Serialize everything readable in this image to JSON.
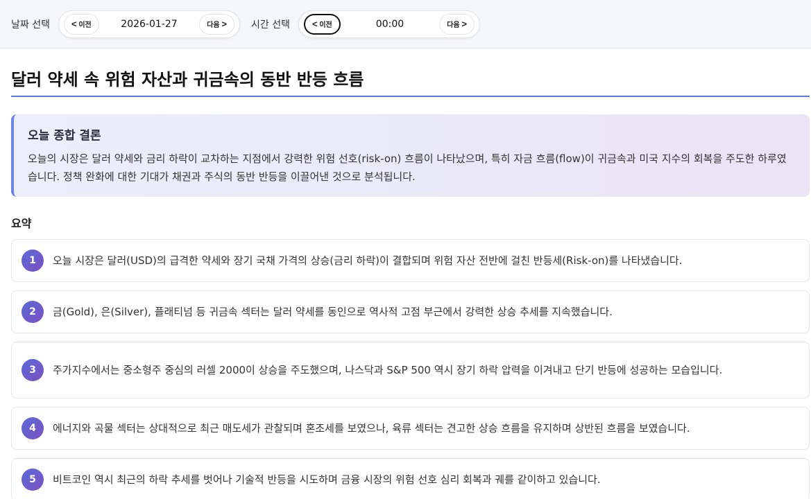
{
  "toolbar": {
    "date_label": "날짜 선택",
    "date_value": "2026-01-27",
    "time_label": "시간 선택",
    "time_value": "00:00",
    "prev_label": "이전",
    "next_label": "다음",
    "prev_glyph": "<",
    "next_glyph": ">"
  },
  "main": {
    "title": "달러 약세 속 위험 자산과 귀금속의 동반 반등 흐름",
    "conclusion": {
      "heading": "오늘 종합 결론",
      "body": "오늘의 시장은 달러 약세와 금리 하락이 교차하는 지점에서 강력한 위험 선호(risk-on) 흐름이 나타났으며, 특히 자금 흐름(flow)이 귀금속과 미국 지수의 회복을 주도한 하루였습니다. 정책 완화에 대한 기대가 채권과 주식의 동반 반등을 이끌어낸 것으로 분석됩니다."
    },
    "summary_title": "요약",
    "summary_items": [
      {
        "num": "1",
        "text": "오늘 시장은 달러(USD)의 급격한 약세와 장기 국채 가격의 상승(금리 하락)이 결합되며 위험 자산 전반에 걸친 반등세(Risk-on)를 나타냈습니다."
      },
      {
        "num": "2",
        "text": "금(Gold), 은(Silver), 플래티넘 등 귀금속 섹터는 달러 약세를 동인으로 역사적 고점 부근에서 강력한 상승 추세를 지속했습니다."
      },
      {
        "num": "3",
        "text": "주가지수에서는 중소형주 중심의 러셀 2000이 상승을 주도했으며, 나스닥과 S&P 500 역시 장기 하락 압력을 이겨내고 단기 반등에 성공하는 모습입니다."
      },
      {
        "num": "4",
        "text": "에너지와 곡물 섹터는 상대적으로 최근 매도세가 관찰되며 혼조세를 보였으나, 육류 섹터는 견고한 상승 흐름을 유지하며 상반된 흐름을 보였습니다."
      },
      {
        "num": "5",
        "text": "비트코인 역시 최근의 하락 추세를 벗어나 기술적 반등을 시도하며 금융 시장의 위험 선호 심리 회복과 궤를 같이하고 있습니다."
      }
    ]
  },
  "colors": {
    "accent": "#5b79d6",
    "badge_start": "#5a6bd8",
    "badge_end": "#7c4fc0"
  }
}
